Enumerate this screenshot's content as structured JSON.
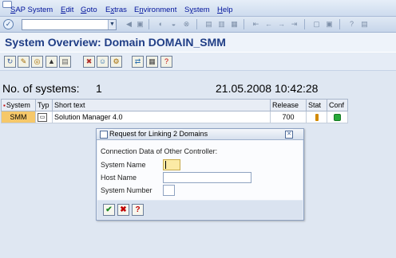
{
  "menu": {
    "items": [
      "SAP System",
      "Edit",
      "Goto",
      "Extras",
      "Environment",
      "System",
      "Help"
    ],
    "underlines": [
      "S",
      "E",
      "G",
      "x",
      "n",
      "y",
      "H"
    ]
  },
  "command_field": {
    "value": ""
  },
  "page": {
    "title": "System Overview: Domain DOMAIN_SMM"
  },
  "summary": {
    "label": "No. of systems:",
    "count": "1",
    "datetime": "21.05.2008 10:42:28"
  },
  "table": {
    "headers": [
      "System",
      "Typ",
      "Short text",
      "Release",
      "Stat",
      "Conf"
    ],
    "rows": [
      {
        "system": "SMM",
        "text": "Solution Manager 4.0",
        "release": "700",
        "stat": "warning",
        "conf": "green"
      }
    ]
  },
  "dialog": {
    "title": "Request for Linking 2 Domains",
    "section": "Connection Data of Other Controller:",
    "fields": [
      {
        "label": "System Name",
        "value": ""
      },
      {
        "label": "Host Name",
        "value": ""
      },
      {
        "label": "System Number",
        "value": ""
      }
    ]
  },
  "icons": {
    "enter": "enter-icon",
    "close": "close-icon",
    "continue": "checkmark-icon",
    "cancel": "cancel-icon",
    "help": "help-icon"
  },
  "colors": {
    "title": "#203e86",
    "system_cell": "#f6c86a",
    "status_ok": "#27a93a",
    "status_warn": "#d28a00"
  }
}
